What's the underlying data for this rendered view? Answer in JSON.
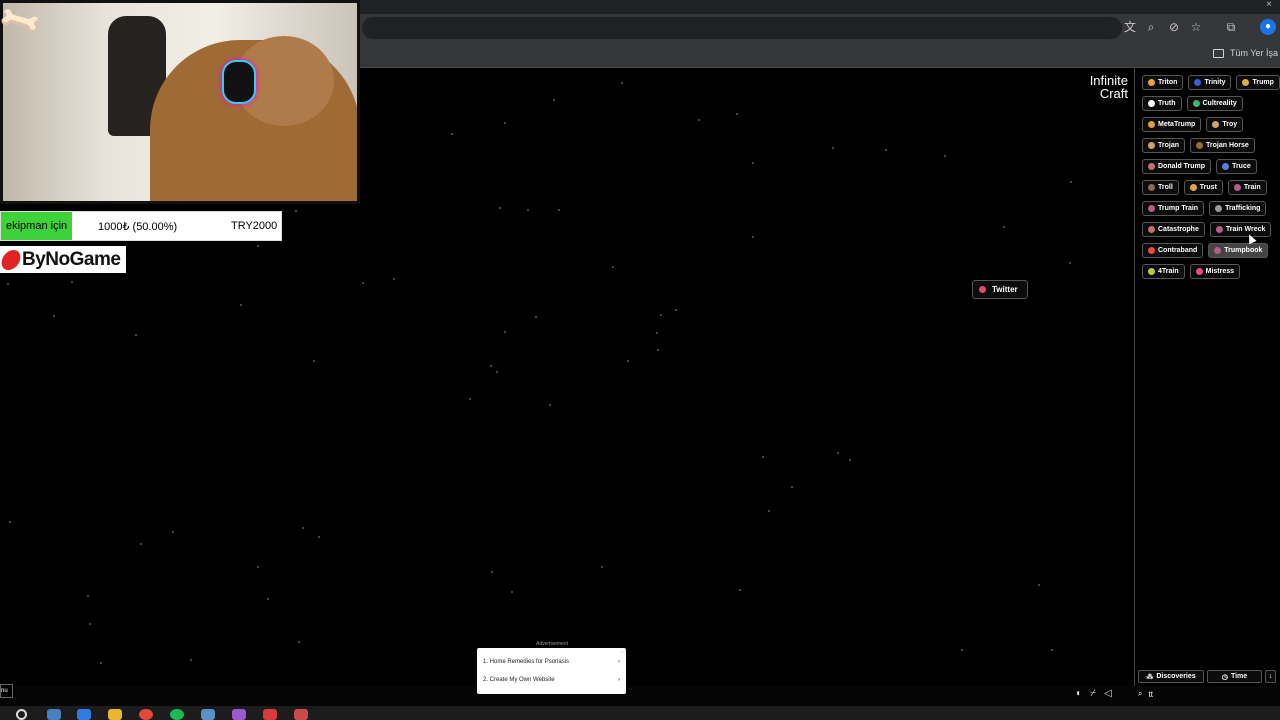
{
  "browser": {
    "bookmarks_all_label": "Tüm Yer İşa",
    "toolbar_icons": [
      "translate-icon",
      "zoom-icon",
      "eye-off-icon",
      "star-icon",
      "extensions-icon",
      "profile-icon"
    ]
  },
  "app": {
    "logo_line1": "Infinite",
    "logo_line2": "Craft"
  },
  "stage": {
    "item_label": "Twitter",
    "item_color": "#e64a6e"
  },
  "sidebar": {
    "items": [
      {
        "label": "Triton",
        "color": "#e8a33d"
      },
      {
        "label": "Trinity",
        "color": "#3c5fd8"
      },
      {
        "label": "Trump",
        "color": "#e0b03a"
      },
      {
        "label": "Truth",
        "color": "#ffffff"
      },
      {
        "label": "Cultreality",
        "color": "#3bb76f"
      },
      {
        "label": "MetaTrump",
        "color": "#e89a3b"
      },
      {
        "label": "Troy",
        "color": "#c9a56b"
      },
      {
        "label": "Trojan",
        "color": "#c9a56b"
      },
      {
        "label": "Trojan Horse",
        "color": "#9a6a3c"
      },
      {
        "label": "Donald Trump",
        "color": "#c76c6c"
      },
      {
        "label": "Truce",
        "color": "#5b7fd8"
      },
      {
        "label": "Troll",
        "color": "#8a6d4f"
      },
      {
        "label": "Trust",
        "color": "#e8a33d"
      },
      {
        "label": "Train",
        "color": "#b55c8a"
      },
      {
        "label": "Trump Train",
        "color": "#b55c8a"
      },
      {
        "label": "Trafficking",
        "color": "#9a9a9a"
      },
      {
        "label": "Catastrophe",
        "color": "#c76c6c"
      },
      {
        "label": "Train Wreck",
        "color": "#b55c8a"
      },
      {
        "label": "Contraband",
        "color": "#e64a4a"
      },
      {
        "label": "Trumpbook",
        "color": "#b55c8a"
      },
      {
        "label": "4Train",
        "color": "#b8c94a"
      },
      {
        "label": "Mistress",
        "color": "#e64a8a"
      }
    ],
    "footer": {
      "discoveries_label": "Discoveries",
      "time_label": "Time"
    },
    "search_value": "tt"
  },
  "stream_overlay": {
    "donation_left": "ekipman için",
    "donation_amount": "1000₺ (50.00%)",
    "donation_goal": "TRY2000",
    "donation_progress": 0.5,
    "brand_name": "ByNoGame"
  },
  "ad": {
    "label": "Advertisement",
    "rows": [
      "1. Home Remedies for Psoriasis",
      "2. Create My Own Website"
    ]
  },
  "mini_label": "nu"
}
